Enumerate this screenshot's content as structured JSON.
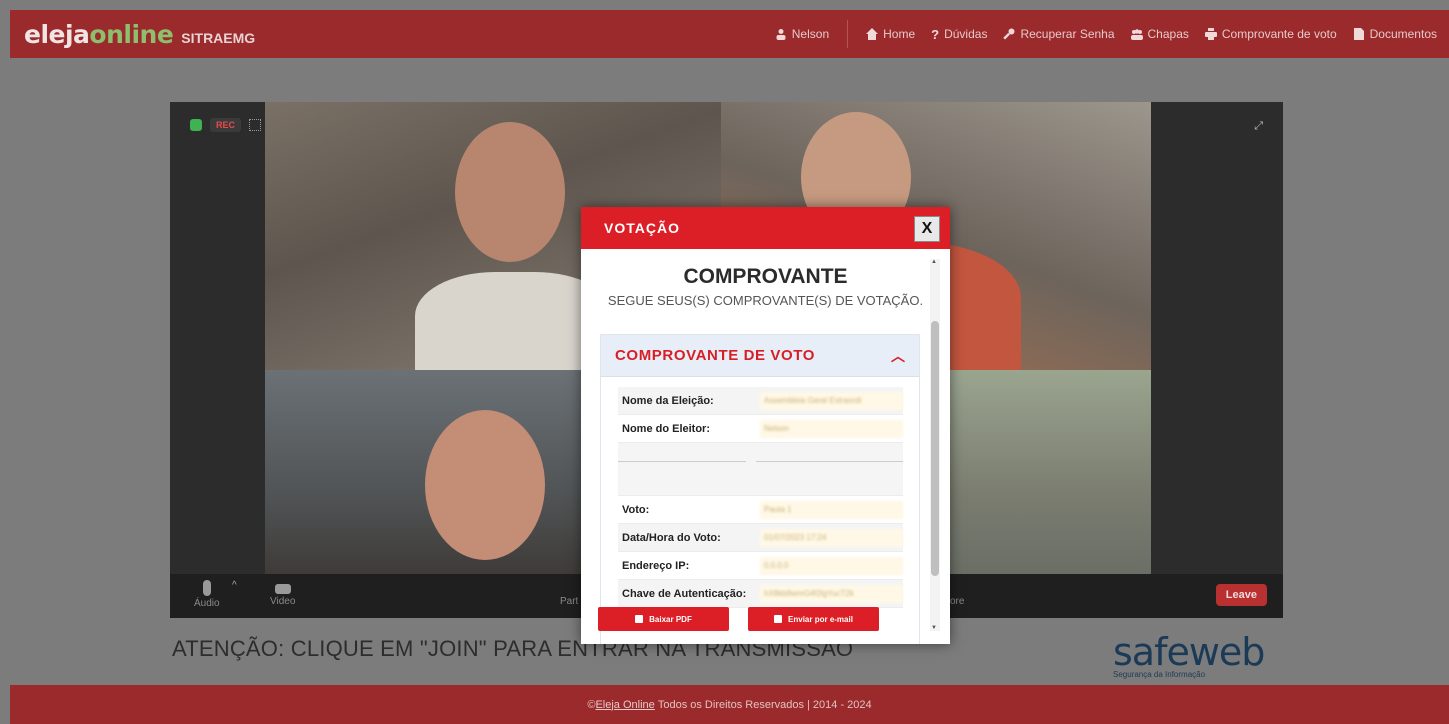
{
  "header": {
    "logo_part1": "eleja",
    "logo_part2": "online",
    "org": "SITRAEMG",
    "user": "Nelson",
    "nav": [
      {
        "label": "Home",
        "icon": "home-icon"
      },
      {
        "label": "Dúvidas",
        "icon": "question-icon"
      },
      {
        "label": "Recuperar Senha",
        "icon": "key-icon"
      },
      {
        "label": "Chapas",
        "icon": "users-icon"
      },
      {
        "label": "Comprovante de voto",
        "icon": "printer-icon"
      },
      {
        "label": "Documentos",
        "icon": "document-icon"
      }
    ]
  },
  "video": {
    "rec_label": "REC",
    "controls": {
      "audio": "Áudio",
      "video": "Video",
      "participants": "Part",
      "more": "ore"
    },
    "leave": "Leave"
  },
  "notice": "ATENÇÃO: CLIQUE EM \"JOIN\" PARA ENTRAR NA TRANSMISSÃO",
  "sponsor": {
    "name": "safeweb",
    "tagline": "Segurança da Informação"
  },
  "footer": {
    "link": "Eleja Online",
    "copy_symbol": "©",
    "text": "Todos os Direitos Reservados | 2014 - 2024"
  },
  "modal": {
    "title": "VOTAÇÃO",
    "close": "X",
    "heading": "COMPROVANTE",
    "subheading": "SEGUE SEUS(S) COMPROVANTE(S) DE VOTAÇÃO.",
    "section": "COMPROVANTE DE VOTO",
    "rows": [
      {
        "k": "Nome da Eleição:",
        "v": "Assembleia Geral Extraordi"
      },
      {
        "k": "Nome do Eleitor:",
        "v": "Nelson"
      },
      {
        "k": "Voto:",
        "v": "Pauta 1"
      },
      {
        "k": "Data/Hora do Voto:",
        "v": "01/07/2023 17:24"
      },
      {
        "k": "Endereço IP:",
        "v": "0.0.0.0"
      },
      {
        "k": "Chave de Autenticação:",
        "v": "hX8kb9wmG4f2lgYucT2k"
      }
    ],
    "btn_pdf": "Baixar PDF",
    "btn_email": "Enviar por e-mail"
  },
  "colors": {
    "brand_red": "#dc1f26",
    "header_red": "#9b2a2c",
    "logo_green": "#8dbf6d",
    "safeweb_blue": "#1a3a57"
  }
}
